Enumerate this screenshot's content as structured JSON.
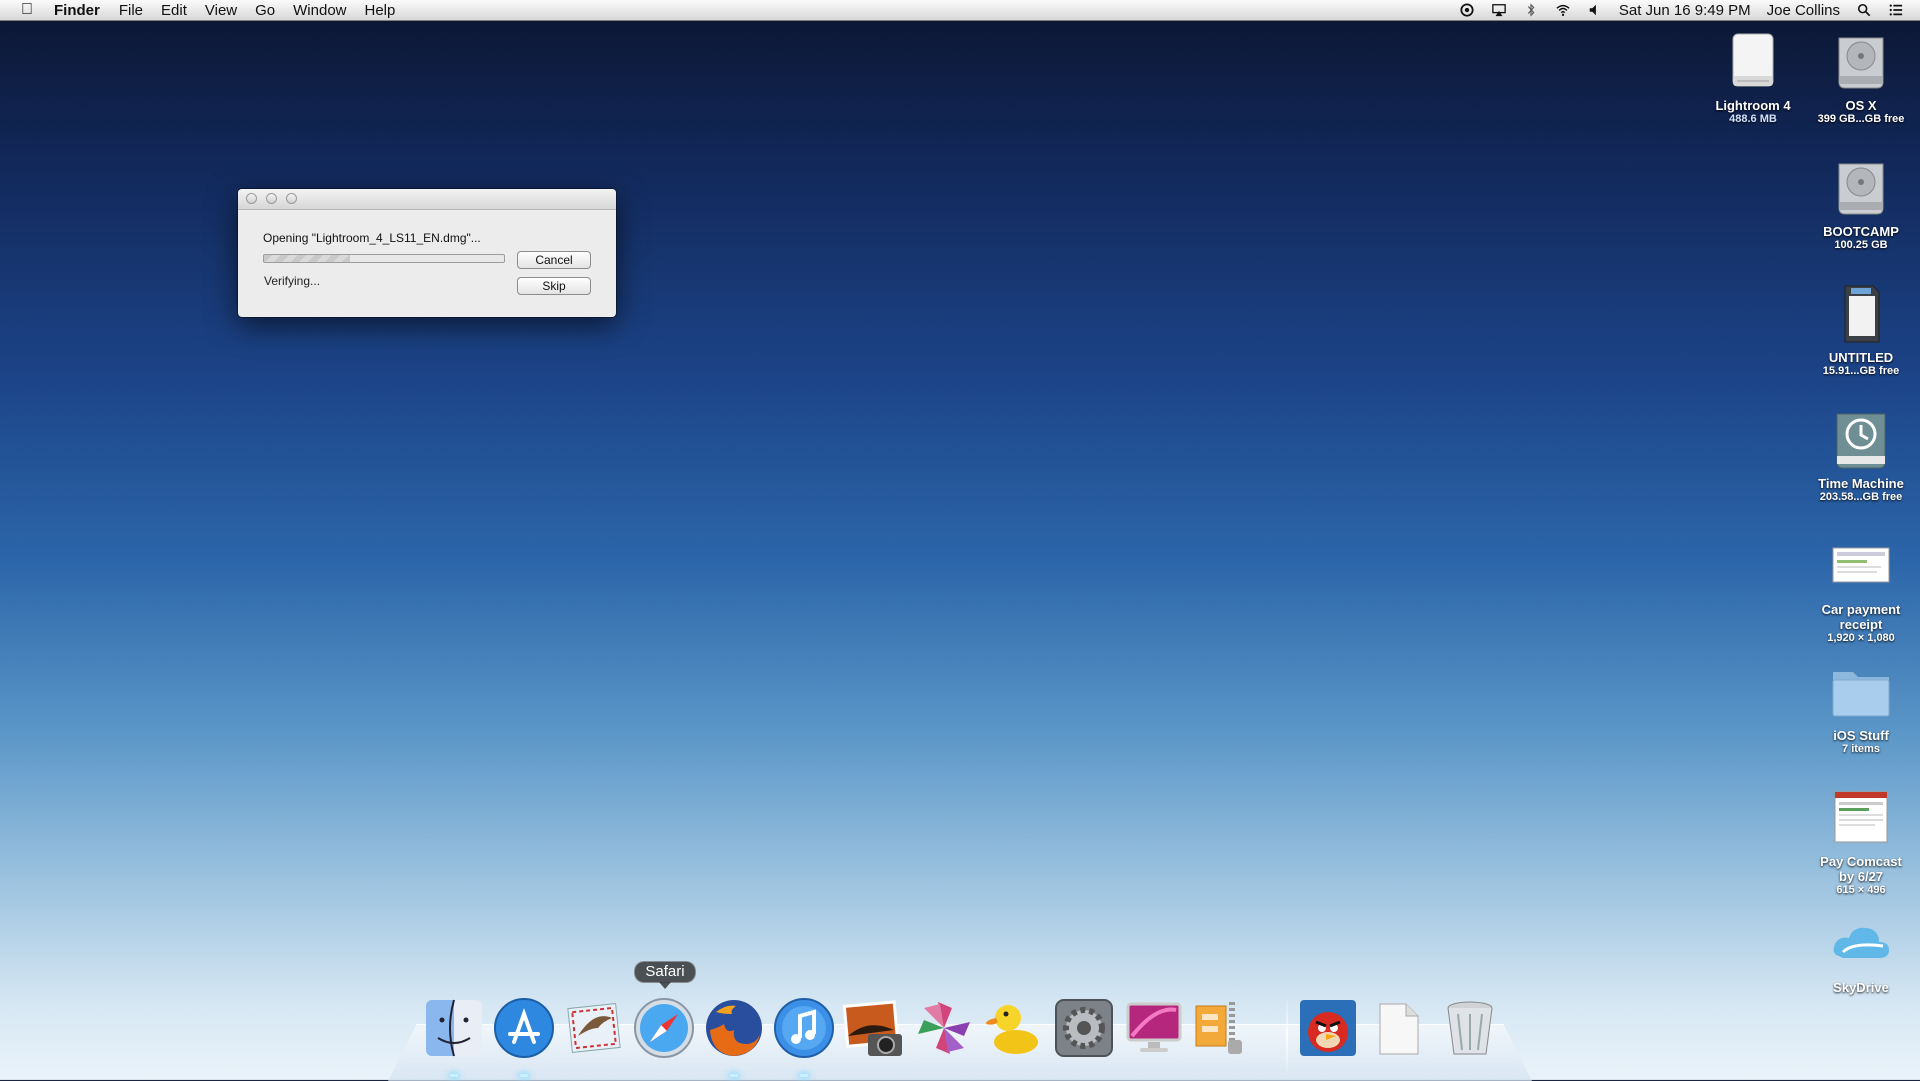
{
  "menubar": {
    "app_name": "Finder",
    "items": [
      "File",
      "Edit",
      "View",
      "Go",
      "Window",
      "Help"
    ],
    "datetime": "Sat Jun 16  9:49 PM",
    "user": "Joe Collins"
  },
  "desktop_icons": [
    {
      "label": "Lightroom 4",
      "sub": "488.6 MB"
    },
    {
      "label": "OS X",
      "sub": "399 GB...GB free"
    },
    {
      "label": "BOOTCAMP",
      "sub": "100.25 GB"
    },
    {
      "label": "UNTITLED",
      "sub": "15.91...GB free"
    },
    {
      "label": "Time Machine",
      "sub": "203.58...GB free"
    },
    {
      "label": "Car payment receipt",
      "sub": "1,920 × 1,080"
    },
    {
      "label": "iOS Stuff",
      "sub": "7 items"
    },
    {
      "label": "Pay Comcast by 6/27",
      "sub": "615 × 496"
    },
    {
      "label": "SkyDrive",
      "sub": ""
    }
  ],
  "dialog": {
    "message": "Opening \"Lightroom_4_LS11_EN.dmg\"...",
    "status": "Verifying...",
    "progress": 0.36,
    "cancel_label": "Cancel",
    "skip_label": "Skip"
  },
  "dock": {
    "tooltip": "Safari",
    "apps": [
      "finder-icon",
      "app-store-icon",
      "mail-icon",
      "safari-icon",
      "firefox-icon",
      "itunes-icon",
      "iphoto-icon",
      "pinwheel-icon",
      "cyberduck-icon",
      "system-preferences-icon",
      "cleanmymac-icon",
      "archive-utility-icon",
      "angry-birds-icon",
      "documents-stack-icon",
      "trash-icon"
    ]
  }
}
